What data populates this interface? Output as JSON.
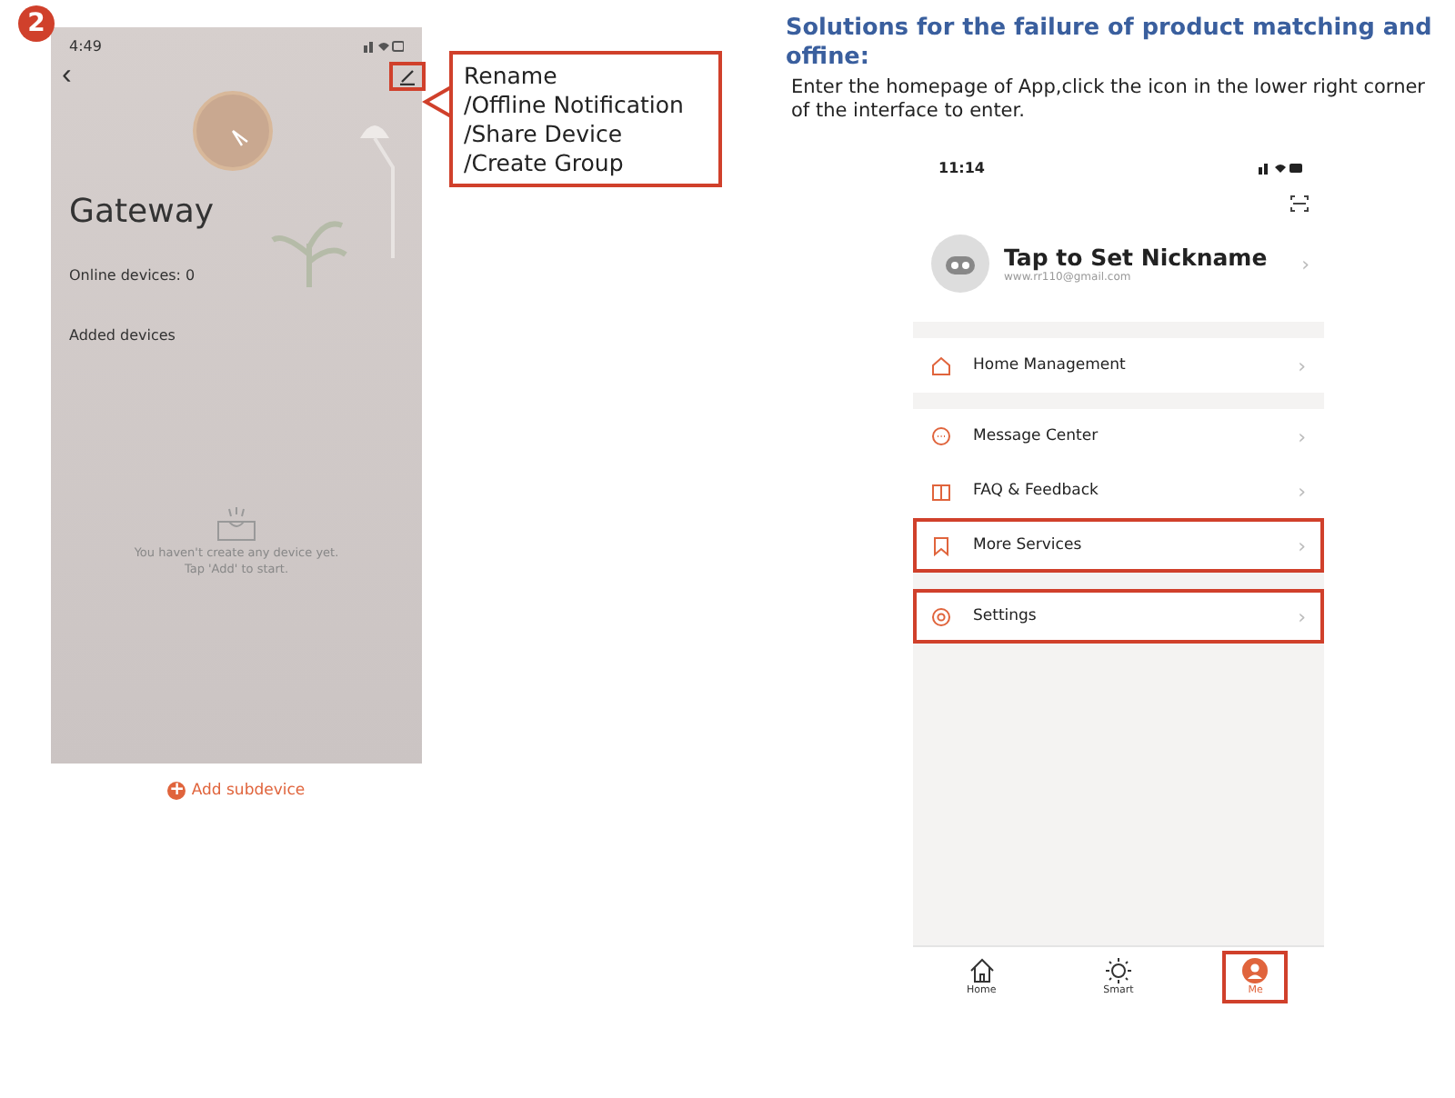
{
  "step_badge": "2",
  "left_phone": {
    "status_time": "4:49",
    "back": "‹",
    "edit_highlighted": true,
    "title": "Gateway",
    "online_label": "Online devices: 0",
    "added_label": "Added devices",
    "empty_lines": [
      "You haven't create any device yet.",
      "Tap 'Add' to start."
    ]
  },
  "callout": {
    "lines": [
      "Rename",
      "/Offline Notification",
      "/Share Device",
      "/Create Group"
    ]
  },
  "add_button": {
    "icon": "+",
    "label": "Add subdevice"
  },
  "instructions": {
    "title": "Solutions for the failure of product matching and offine:",
    "body": "Enter the homepage of App,click the icon in the lower right corner of the interface to enter."
  },
  "right_phone": {
    "status_time": "11:14",
    "profile": {
      "name": "Tap to Set Nickname",
      "email": "www.rr110@gmail.com",
      "chevron": "›"
    },
    "menu_groups": [
      [
        {
          "kind": "home",
          "label": "Home Management",
          "chevron": "›",
          "highlighted": false
        }
      ],
      [
        {
          "kind": "message",
          "label": "Message Center",
          "chevron": "›",
          "highlighted": false
        },
        {
          "kind": "book",
          "label": "FAQ & Feedback",
          "chevron": "›",
          "highlighted": false
        },
        {
          "kind": "bookmark",
          "label": "More Services",
          "chevron": "›",
          "highlighted": true
        }
      ],
      [
        {
          "kind": "gear",
          "label": "Settings",
          "chevron": "›",
          "highlighted": true
        }
      ]
    ],
    "tabs": [
      {
        "kind": "home",
        "label": "Home",
        "selected": false,
        "highlighted": false
      },
      {
        "kind": "sun",
        "label": "Smart",
        "selected": false,
        "highlighted": false
      },
      {
        "kind": "person",
        "label": "Me",
        "selected": true,
        "highlighted": true
      }
    ]
  }
}
